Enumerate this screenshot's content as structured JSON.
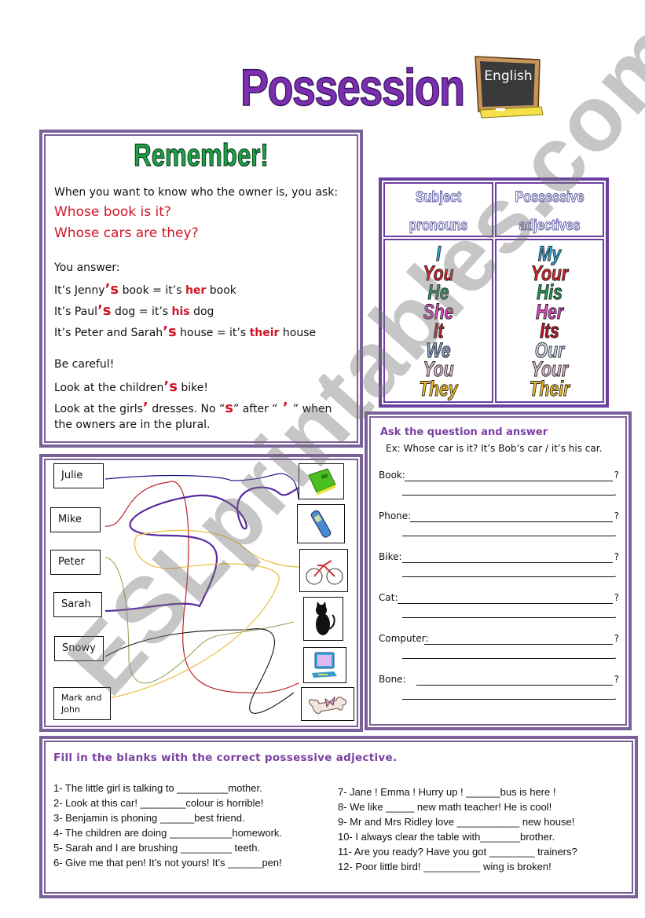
{
  "header": {
    "title": "Possession",
    "board_label": "English"
  },
  "remember": {
    "title": "Remember!",
    "intro": "When you want to know who the owner is, you ask:",
    "questions": [
      "Whose book is it?",
      "Whose cars are they?"
    ],
    "answer_label": "You answer:",
    "examples": [
      {
        "pre": "It’s Jenny",
        "mark": "’s",
        "mid": " book = it’s ",
        "adj": "her",
        "post": " book"
      },
      {
        "pre": "It’s Paul",
        "mark": "’s",
        "mid": " dog = it’s ",
        "adj": "his",
        "post": " dog"
      },
      {
        "pre": "It’s Peter and Sarah",
        "mark": "’s",
        "mid": " house = it’s ",
        "adj": "their",
        "post": " house"
      }
    ],
    "careful_label": "Be careful!",
    "careful_1": {
      "pre": "Look at the children",
      "mark": "’s",
      "post": " bike!"
    },
    "careful_2": {
      "pre": "Look at the girls",
      "mark": "’",
      "mid1": "  dresses. No “",
      "s": "s",
      "mid2": "” after “",
      "mark2": " ’ ",
      "post": " ” when"
    },
    "careful_3": "the owners are in the plural."
  },
  "pronouns": {
    "headers": [
      [
        "Subject",
        "pronouns"
      ],
      [
        "Possessive",
        "adjectives"
      ]
    ],
    "subject": [
      {
        "word": "I",
        "color": "#2aa8d8"
      },
      {
        "word": "You",
        "color": "#e0202a"
      },
      {
        "word": "He",
        "color": "#1f9a55"
      },
      {
        "word": "She",
        "color": "#e04ac0"
      },
      {
        "word": "It",
        "color": "#c0101e"
      },
      {
        "word": "We",
        "color": "#8aa0c8"
      },
      {
        "word": "You",
        "color": "#d8b8d0"
      },
      {
        "word": "They",
        "color": "#f5c020"
      }
    ],
    "possessive": [
      {
        "word": "My",
        "color": "#2aa8d8"
      },
      {
        "word": "Your",
        "color": "#e0202a"
      },
      {
        "word": "His",
        "color": "#1f9a55"
      },
      {
        "word": "Her",
        "color": "#e04ac0"
      },
      {
        "word": "Its",
        "color": "#c0101e"
      },
      {
        "word": "Our",
        "color": "#c8d8ec"
      },
      {
        "word": "Your",
        "color": "#d8b8d0"
      },
      {
        "word": "Their",
        "color": "#f5c020"
      }
    ]
  },
  "matching": {
    "names": [
      "Julie",
      "Mike",
      "Peter",
      "Sarah",
      "Snowy",
      "Mark and John"
    ],
    "pictures": [
      "book-icon",
      "phone-icon",
      "bike-icon",
      "cat-icon",
      "computer-icon",
      "bone-icon"
    ]
  },
  "ask": {
    "title": "Ask the question and answer",
    "example": "Ex:  Whose car is it? It’s Bob’s car / it’s his car.",
    "items": [
      "Book:",
      "Phone:",
      "Bike:",
      "Cat:",
      "Computer:",
      "Bone:"
    ],
    "qmark": "?",
    "dot": "."
  },
  "fill": {
    "title": "Fill in the blanks with the correct possessive adjective.",
    "left": [
      "1-   The little girl is talking to _________mother.",
      "2-   Look at this car! ________colour is horrible!",
      "3-   Benjamin is phoning ______best friend.",
      "4-   The children are doing ___________homework.",
      "5-   Sarah and I are brushing _________ teeth.",
      "6-   Give me that pen! It’s not yours! It’s ______pen!"
    ],
    "right": [
      "7- Jane ! Emma ! Hurry up ! ______bus is here !",
      "8- We like _____ new math teacher! He is cool!",
      "9- Mr and Mrs Ridley love ___________ new house!",
      "10- I always clear the table with_______brother.",
      "11- Are you ready? Have you got ________ trainers?",
      "12- Poor little bird! __________ wing is broken!"
    ]
  },
  "watermark": "ESLprintables.com"
}
